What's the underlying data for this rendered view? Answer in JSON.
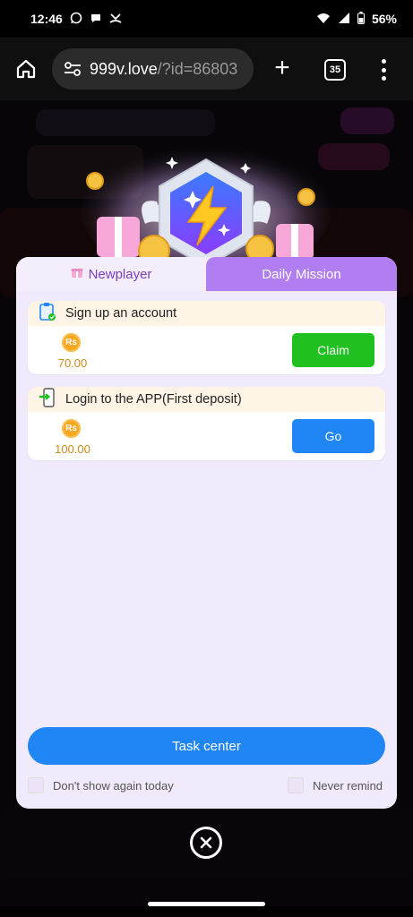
{
  "status_bar": {
    "time": "12:46",
    "battery": "56%",
    "icons": [
      "whatsapp-icon",
      "chat-bubble-icon",
      "missed-call-icon",
      "wifi-icon",
      "signal-icon",
      "battery-icon"
    ]
  },
  "browser": {
    "url_host": "999v.love",
    "url_rest": "/?id=86803",
    "tab_count": "35"
  },
  "modal": {
    "tabs": {
      "newplayer": "Newplayer",
      "daily_mission": "Daily Mission"
    },
    "tasks": [
      {
        "title": "Sign up an account",
        "currency": "Rs",
        "reward": "70.00",
        "button": "Claim",
        "button_color": "#1fc01f",
        "icon": "clipboard-check-icon"
      },
      {
        "title": "Login to the APP(First deposit)",
        "currency": "Rs",
        "reward": "100.00",
        "button": "Go",
        "button_color": "#2186f5",
        "icon": "login-phone-icon"
      }
    ],
    "task_center_label": "Task center",
    "options": {
      "dont_show_today": "Don't show again today",
      "never_remind": "Never remind"
    }
  },
  "colors": {
    "accent_purple": "#b07ef0",
    "tab_text_purple": "#7a3ec0",
    "primary_blue": "#2186f5",
    "claim_green": "#1fc01f",
    "coin_gold": "#f5a623"
  }
}
